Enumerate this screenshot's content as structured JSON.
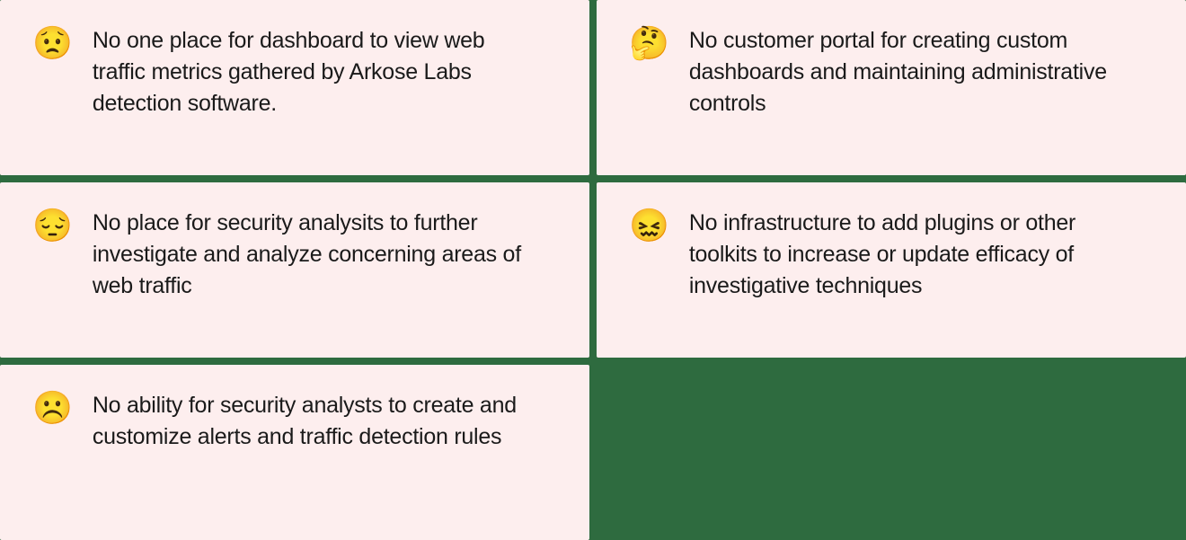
{
  "cards": [
    {
      "emoji": "😟",
      "text": "No one place for dashboard to view web traffic metrics gathered by Arkose Labs detection software."
    },
    {
      "emoji": "🤔",
      "text": "No customer portal for creating custom dashboards and maintaining administrative controls"
    },
    {
      "emoji": "😔",
      "text": "No place for security analysits to further investigate and analyze concerning areas of web traffic"
    },
    {
      "emoji": "😖",
      "text": "No infrastructure to add plugins or other toolkits to increase or update efficacy of investigative techniques"
    },
    {
      "emoji": "☹️",
      "text": "No ability for security analysts to create and customize alerts and traffic detection rules"
    }
  ]
}
